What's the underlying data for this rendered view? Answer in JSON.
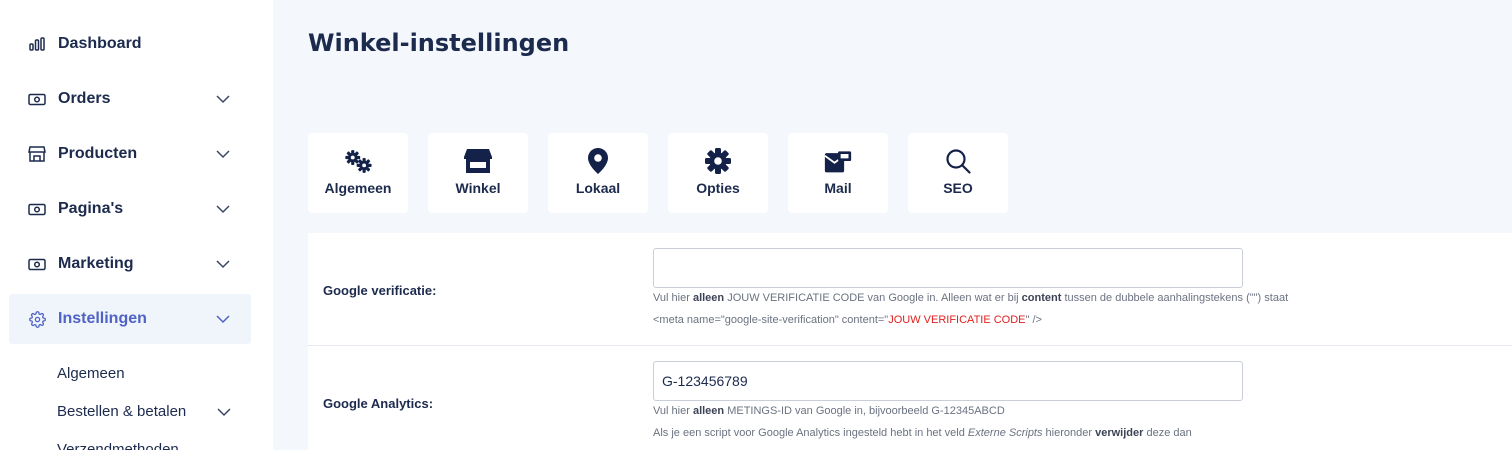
{
  "sidebar": {
    "items": [
      {
        "label": "Dashboard",
        "icon": "bar-chart-icon"
      },
      {
        "label": "Orders",
        "icon": "banknote-icon"
      },
      {
        "label": "Producten",
        "icon": "store-icon"
      },
      {
        "label": "Pagina's",
        "icon": "banknote-icon"
      },
      {
        "label": "Marketing",
        "icon": "banknote-icon"
      },
      {
        "label": "Instellingen",
        "icon": "gear-icon"
      }
    ],
    "sub_items": [
      {
        "label": "Algemeen"
      },
      {
        "label": "Bestellen & betalen"
      },
      {
        "label": "Verzendmethoden"
      }
    ]
  },
  "page": {
    "title": "Winkel-instellingen"
  },
  "tabs": [
    {
      "label": "Algemeen",
      "icon": "gears-icon"
    },
    {
      "label": "Winkel",
      "icon": "storefront-icon"
    },
    {
      "label": "Lokaal",
      "icon": "map-pin-icon"
    },
    {
      "label": "Opties",
      "icon": "gear-icon"
    },
    {
      "label": "Mail",
      "icon": "mail-icon"
    },
    {
      "label": "SEO",
      "icon": "search-icon"
    }
  ],
  "fields": {
    "google_verification": {
      "label": "Google verificatie:",
      "value": "",
      "help_line1": {
        "p1": "Vul hier ",
        "b1": "alleen",
        "p2": " JOUW VERIFICATIE CODE van Google in. Alleen wat er bij ",
        "b2": "content",
        "p3": " tussen de dubbele aanhalingstekens (\"\") staat"
      },
      "help_line2": {
        "p1": "<meta name=\"google-site-verification\" content=\"",
        "red": "JOUW VERIFICATIE CODE",
        "p2": "\" />"
      }
    },
    "google_analytics": {
      "label": "Google Analytics:",
      "value": "G-123456789",
      "help_line1": {
        "p1": "Vul hier ",
        "b1": "alleen",
        "p2": " METINGS-ID van Google in, bijvoorbeeld G-12345ABCD"
      },
      "help_line2": {
        "p1": "Als je een script voor Google Analytics ingesteld hebt in het veld ",
        "i1": "Externe Scripts",
        "p2": " hieronder ",
        "b1": "verwijder",
        "p3": " deze dan"
      }
    }
  },
  "colors": {
    "accent": "#4f62c5",
    "text": "#1c2a4d",
    "background": "#f4f7fc",
    "help_red": "#e02020"
  }
}
